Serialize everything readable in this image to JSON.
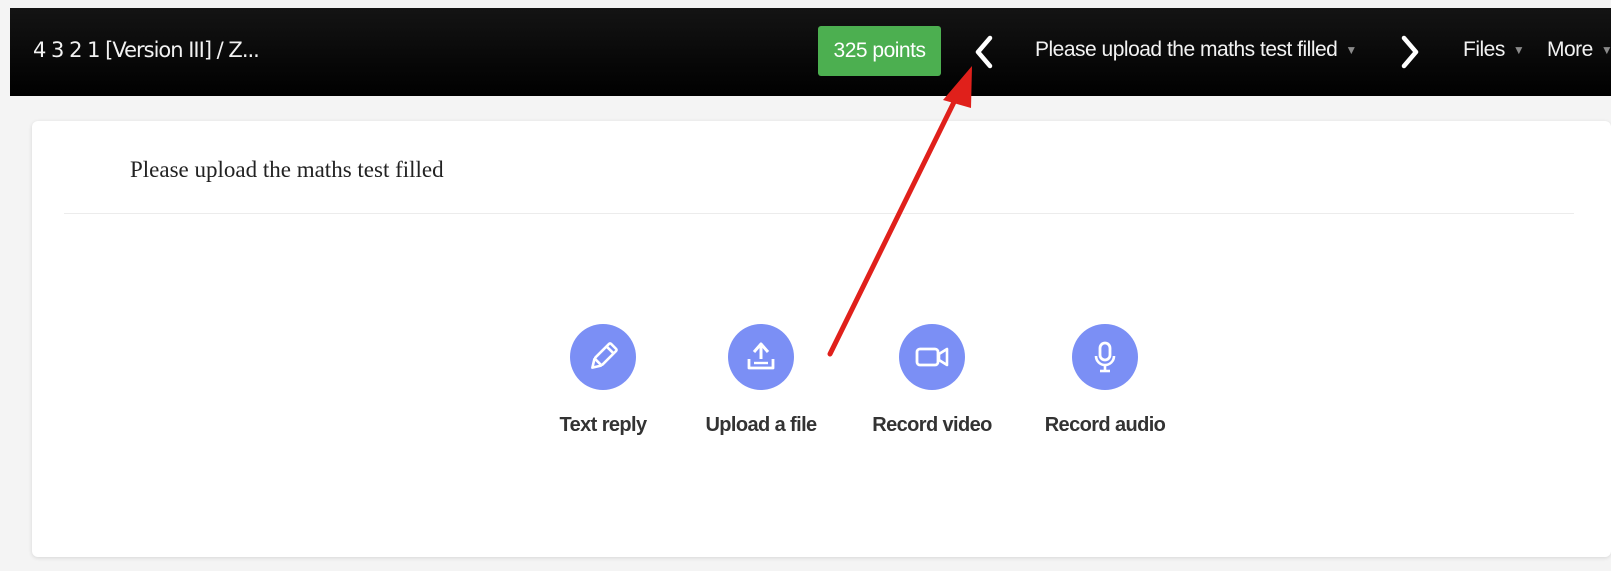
{
  "topbar": {
    "breadcrumb": "4 3 2 1 [Version III] / Z...",
    "points": "325 points",
    "task_menu": "Please upload the maths test filled",
    "files_menu": "Files",
    "more_menu": "More"
  },
  "card": {
    "title": "Please upload the maths test filled",
    "options": [
      {
        "label": "Text reply",
        "icon": "pencil-icon"
      },
      {
        "label": "Upload a file",
        "icon": "upload-icon"
      },
      {
        "label": "Record video",
        "icon": "video-camera-icon"
      },
      {
        "label": "Record audio",
        "icon": "microphone-icon"
      }
    ]
  },
  "colors": {
    "topbar": "#000000",
    "points_badge": "#4caf50",
    "option_circle": "#7b8ff5",
    "annotation_arrow": "#e0201b"
  }
}
